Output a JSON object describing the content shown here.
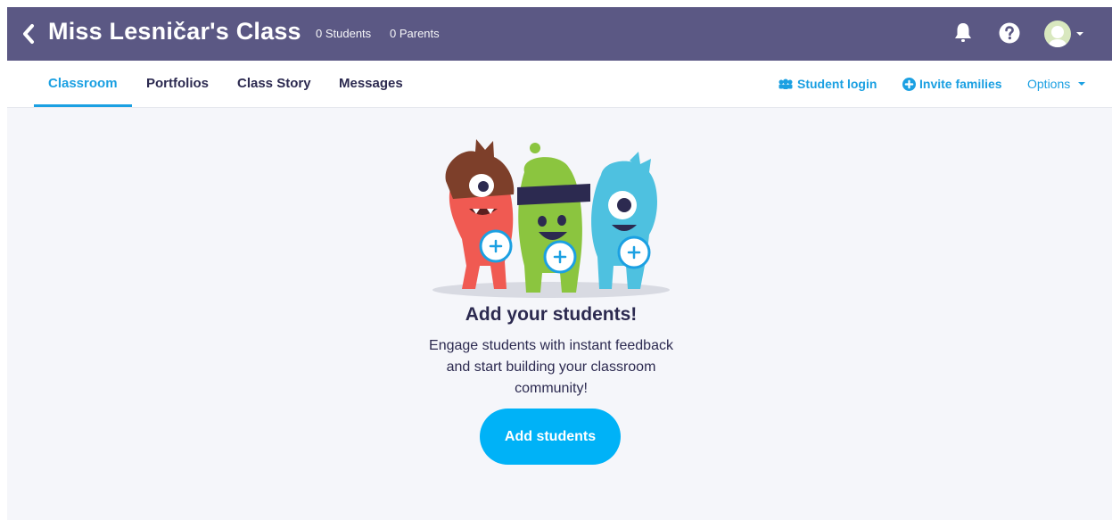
{
  "header": {
    "class_title": "Miss Lesničar's Class",
    "students_count": "0 Students",
    "parents_count": "0 Parents",
    "bg_color": "#5b5884"
  },
  "nav": {
    "tabs": [
      {
        "label": "Classroom",
        "active": true
      },
      {
        "label": "Portfolios",
        "active": false
      },
      {
        "label": "Class Story",
        "active": false
      },
      {
        "label": "Messages",
        "active": false
      }
    ],
    "actions": {
      "student_login": "Student login",
      "invite_families": "Invite families",
      "options": "Options"
    },
    "accent_color": "#1ba0e2"
  },
  "empty_state": {
    "title": "Add your students!",
    "description": "Engage students with instant feedback and start building your classroom community!",
    "button_label": "Add students",
    "button_color": "#00b2f7"
  },
  "icons": [
    "back-chevron-icon",
    "bell-icon",
    "help-icon",
    "avatar",
    "caret-down-icon",
    "student-login-icon",
    "plus-circle-icon",
    "monsters-illustration"
  ]
}
